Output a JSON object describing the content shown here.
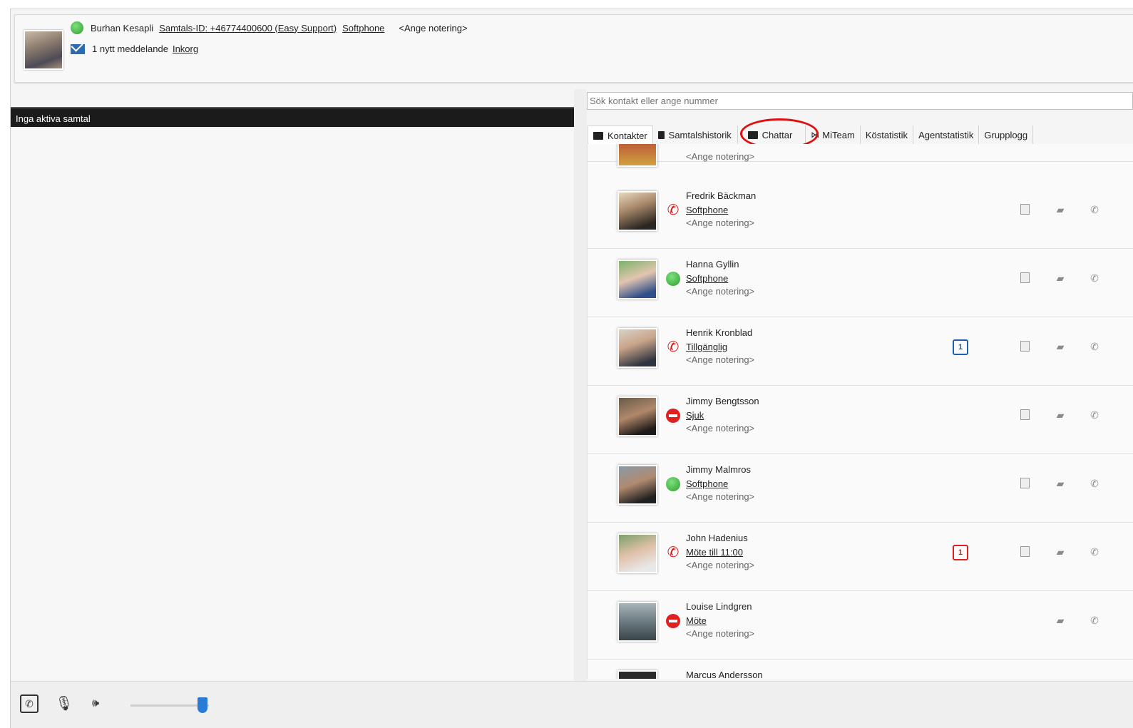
{
  "header": {
    "user_name": "Burhan Kesapli",
    "call_id": "Samtals-ID: +46774400600 (Easy Support)",
    "device": "Softphone",
    "note_placeholder": "<Ange notering>",
    "messages_text": "1 nytt meddelande",
    "inbox_link": "Inkorg"
  },
  "calls": {
    "bar_label": "Inga aktiva samtal"
  },
  "search": {
    "placeholder": "Sök kontakt eller ange nummer"
  },
  "tabs": [
    {
      "label": "Kontakter",
      "active": true
    },
    {
      "label": "Samtalshistorik"
    },
    {
      "label": "Chattar"
    },
    {
      "label": "MiTeam"
    },
    {
      "label": "Köstatistik"
    },
    {
      "label": "Agentstatistik"
    },
    {
      "label": "Grupplogg"
    }
  ],
  "contacts": [
    {
      "name": "",
      "status": "",
      "note": "<Ange notering>",
      "indicator": "partial"
    },
    {
      "name": "Fredrik Bäckman",
      "status": "Softphone",
      "note": "<Ange notering>",
      "indicator": "phone"
    },
    {
      "name": "Hanna Gyllin",
      "status": "Softphone",
      "note": "<Ange notering>",
      "indicator": "green"
    },
    {
      "name": "Henrik Kronblad",
      "status": "Tillgänglig",
      "note": "<Ange notering>",
      "indicator": "phone",
      "badge": "1",
      "badge_color": "#1a5fb4"
    },
    {
      "name": "Jimmy Bengtsson",
      "status": "Sjuk",
      "note": "<Ange notering>",
      "indicator": "busy"
    },
    {
      "name": "Jimmy Malmros",
      "status": "Softphone",
      "note": "<Ange notering>",
      "indicator": "green"
    },
    {
      "name": "John Hadenius",
      "status": "Möte till 11:00",
      "note": "<Ange notering>",
      "indicator": "phone",
      "badge": "1",
      "badge_color": "#e02020"
    },
    {
      "name": "Louise Lindgren",
      "status": "Möte",
      "note": "<Ange notering>",
      "indicator": "busy"
    },
    {
      "name": "Marcus Andersson",
      "status": "",
      "note": "",
      "indicator": ""
    }
  ]
}
